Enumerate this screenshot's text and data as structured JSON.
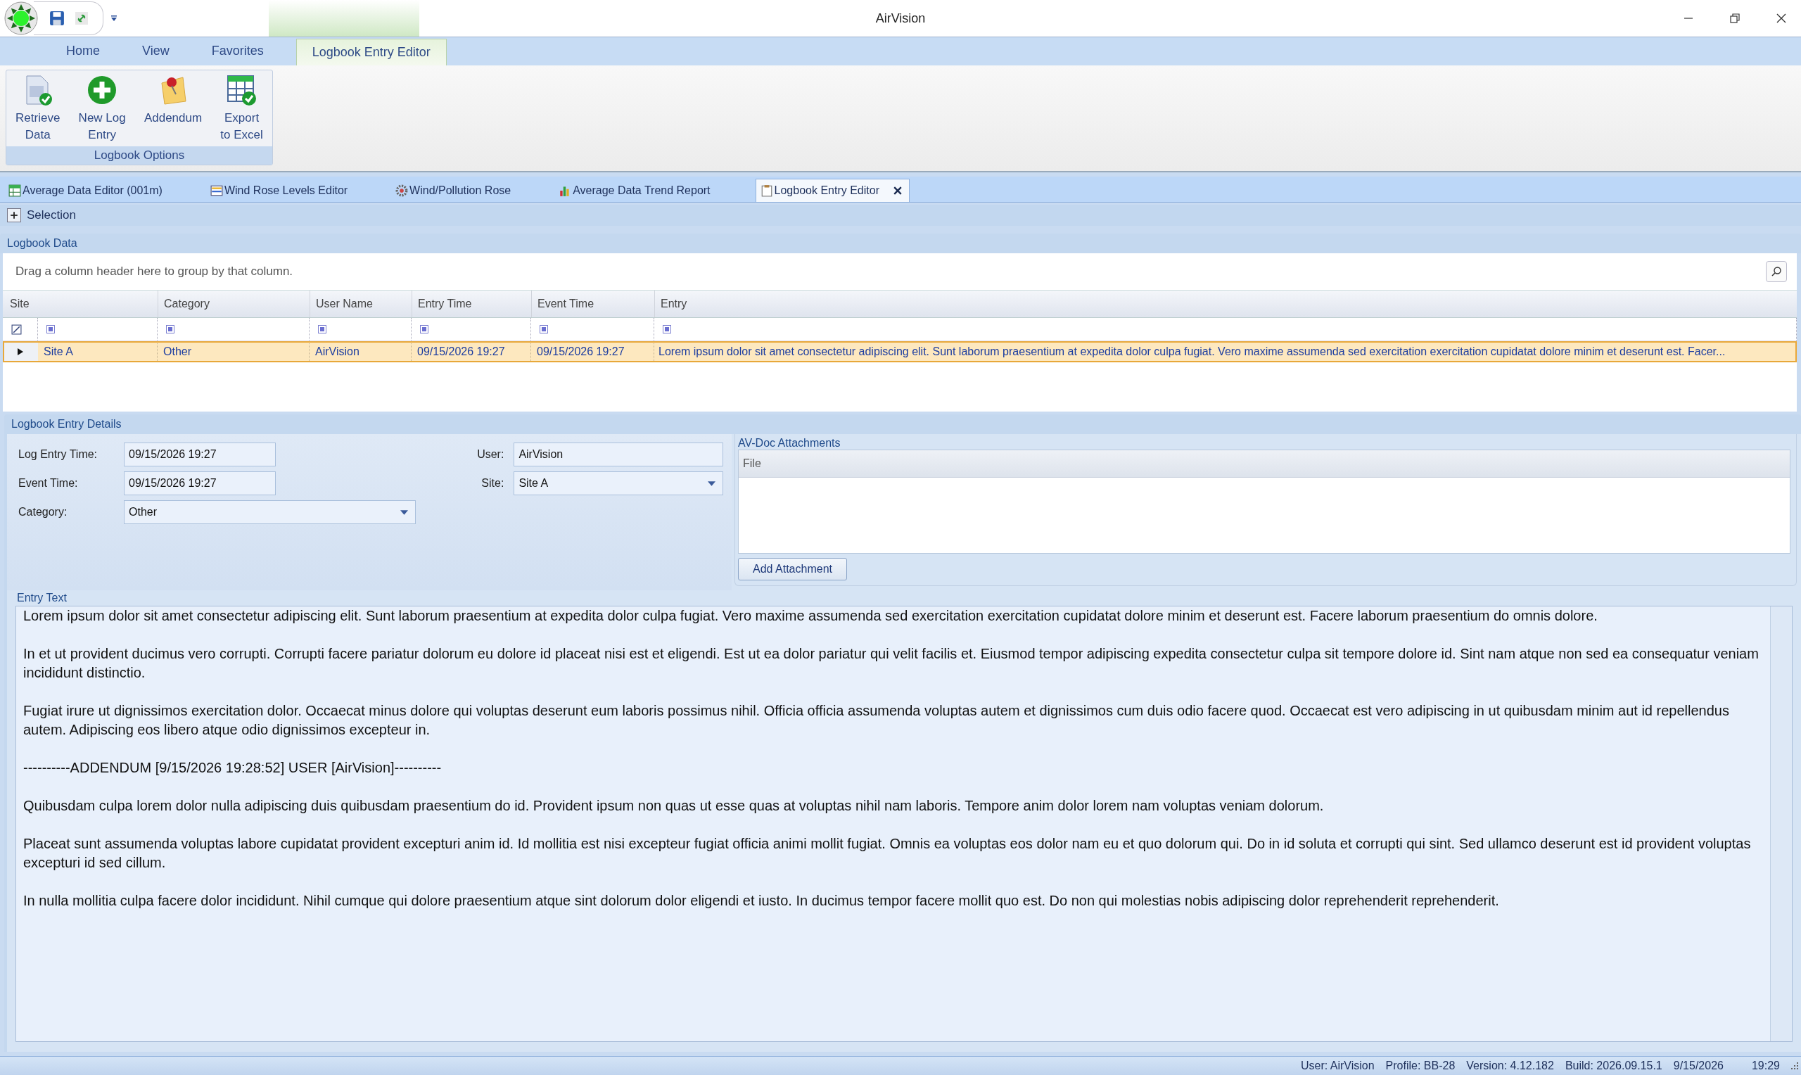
{
  "window": {
    "title": "AirVision"
  },
  "ribbon_tabs": [
    {
      "label": "Home",
      "selected": false
    },
    {
      "label": "View",
      "selected": false
    },
    {
      "label": "Favorites",
      "selected": false
    },
    {
      "label": "Logbook Entry Editor",
      "selected": true
    }
  ],
  "ribbon_group": {
    "title": "Logbook Options",
    "buttons": [
      {
        "lines": [
          "Retrieve",
          "Data"
        ]
      },
      {
        "lines": [
          "New Log",
          "Entry"
        ]
      },
      {
        "lines": [
          "Addendum"
        ]
      },
      {
        "lines": [
          "Export",
          "to Excel"
        ]
      }
    ]
  },
  "document_tabs": [
    {
      "label": "Average Data Editor (001m)",
      "selected": false
    },
    {
      "label": "Wind Rose Levels Editor",
      "selected": false
    },
    {
      "label": "Wind/Pollution Rose",
      "selected": false
    },
    {
      "label": "Average Data Trend Report",
      "selected": false
    },
    {
      "label": "Logbook Entry Editor",
      "selected": true
    }
  ],
  "selection_panel": {
    "label": "Selection",
    "expanded": false
  },
  "logbook_data": {
    "title": "Logbook Data",
    "group_hint": "Drag a column header here to group by that column.",
    "columns": [
      "Site",
      "Category",
      "User Name",
      "Entry Time",
      "Event Time",
      "Entry"
    ],
    "rows": [
      {
        "selected": true,
        "cells": [
          "Site A",
          "Other",
          "AirVision",
          "09/15/2026  19:27",
          "09/15/2026  19:27",
          "Lorem ipsum dolor sit amet consectetur adipiscing elit. Sunt laborum praesentium at expedita dolor culpa fugiat. Vero maxime assumenda sed exercitation exercitation cupidatat dolore minim et deserunt est. Facer..."
        ]
      }
    ]
  },
  "details": {
    "title": "Logbook Entry Details",
    "left_fields": [
      {
        "label": "Log Entry Time:",
        "value": "09/15/2026  19:27",
        "kind": "text"
      },
      {
        "label": "Event Time:",
        "value": "09/15/2026  19:27",
        "kind": "text"
      },
      {
        "label": "Category:",
        "value": "Other",
        "kind": "dropdown"
      }
    ],
    "right_fields": [
      {
        "label": "User:",
        "value": "AirVision",
        "kind": "text"
      },
      {
        "label": "Site:",
        "value": "Site A",
        "kind": "dropdown"
      }
    ],
    "attachments": {
      "title": "AV-Doc Attachments",
      "columns": [
        "File"
      ],
      "button": "Add Attachment"
    },
    "entry_text": {
      "label": "Entry Text",
      "paragraphs": [
        "Lorem ipsum dolor sit amet consectetur adipiscing elit. Sunt laborum praesentium at expedita dolor culpa fugiat. Vero maxime assumenda sed exercitation exercitation cupidatat dolore minim et deserunt est. Facere laborum praesentium do omnis dolore.",
        "In et ut provident ducimus vero corrupti. Corrupti facere pariatur dolorum eu dolore id placeat nisi est et eligendi. Est ut ea dolor pariatur qui velit facilis et. Eiusmod tempor adipiscing expedita consectetur culpa sit tempore dolore id. Sint nam atque non sed ea consequatur veniam incididunt distinctio.",
        "Fugiat irure ut dignissimos exercitation dolor. Occaecat minus dolore qui voluptas deserunt eum laboris possimus nihil. Officia officia assumenda voluptas autem et dignissimos cum duis odio facere quod. Occaecat est vero adipiscing in ut quibusdam minim aut id repellendus autem. Adipiscing eos libero atque odio dignissimos excepteur in.",
        "----------ADDENDUM  [9/15/2026  19:28:52]  USER  [AirVision]----------",
        "Quibusdam culpa lorem dolor nulla adipiscing duis quibusdam praesentium do id. Provident ipsum non quas ut esse quas at voluptas nihil nam laboris. Tempore anim dolor lorem nam voluptas veniam dolorum.",
        "Placeat sunt assumenda voluptas labore cupidatat provident excepturi anim id. Id mollitia est nisi excepteur fugiat officia animi mollit fugiat. Omnis ea voluptas eos dolor nam eu et quo dolorum qui. Do in id soluta et corrupti qui sint. Sed ullamco deserunt est id provident voluptas excepturi id sed cillum.",
        "In nulla mollitia culpa facere dolor incididunt. Nihil cumque qui dolore praesentium atque sint dolorum dolor eligendi et iusto. In ducimus tempor facere mollit quo est. Do non qui molestias nobis adipiscing dolor reprehenderit reprehenderit."
      ]
    }
  },
  "status_bar": [
    "User: AirVision",
    "Profile: BB-28",
    "Version: 4.12.182",
    "Build: 2026.09.15.1",
    "9/15/2026",
    "19:29"
  ]
}
